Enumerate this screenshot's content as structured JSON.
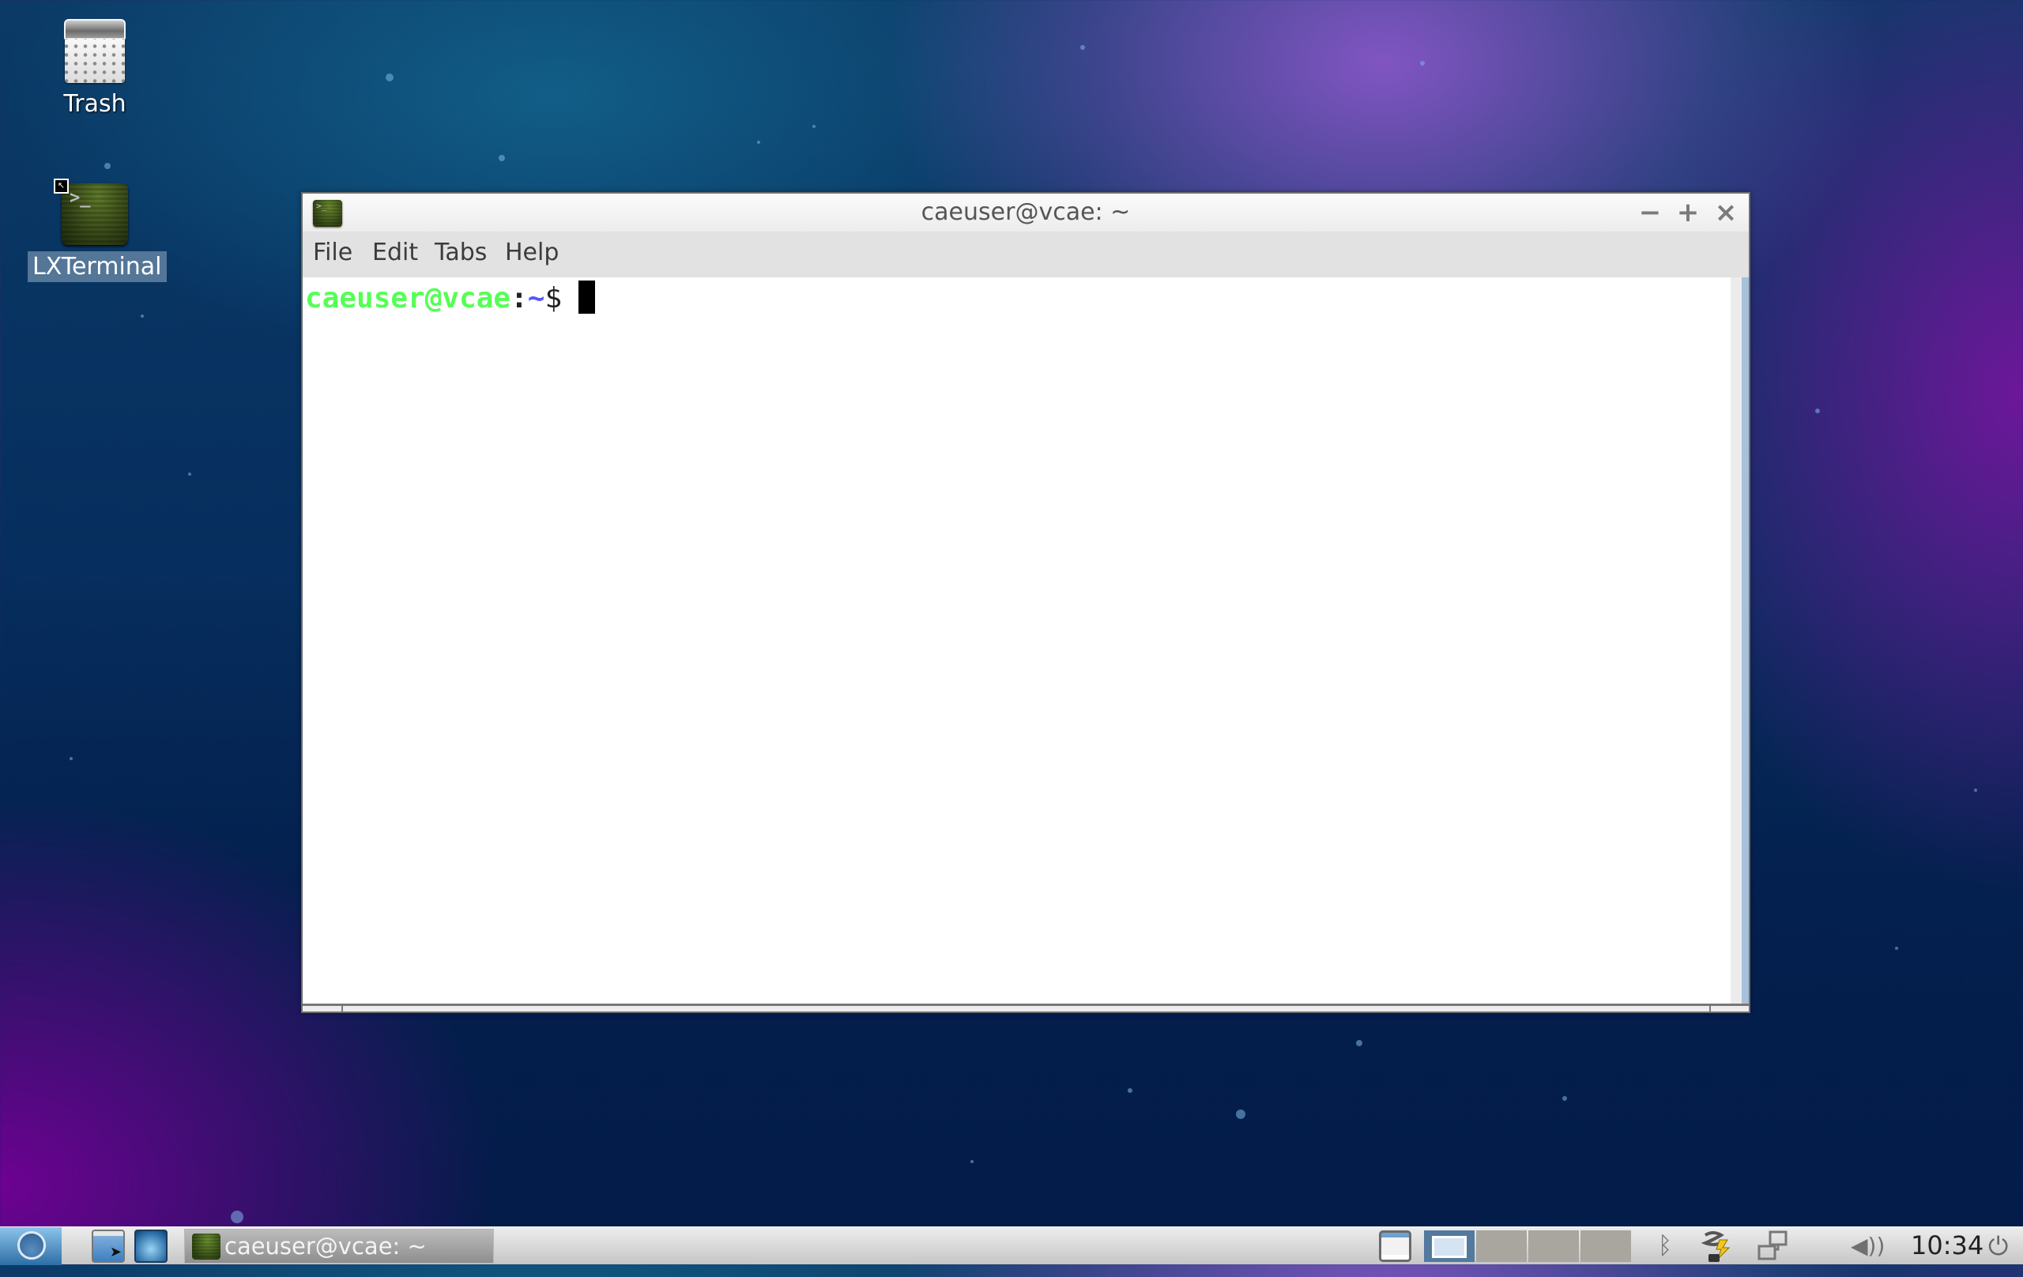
{
  "desktop": {
    "icons": [
      {
        "label": "Trash",
        "icon": "trash-icon"
      },
      {
        "label": "LXTerminal",
        "icon": "terminal-icon",
        "selected": true
      }
    ]
  },
  "window": {
    "title": "caeuser@vcae: ~",
    "controls": {
      "minimize": "−",
      "maximize": "+",
      "close": "×"
    },
    "menu": [
      "File",
      "Edit",
      "Tabs",
      "Help"
    ],
    "terminal": {
      "user_host": "caeuser@vcae",
      "colon": ":",
      "path": "~",
      "dollar": "$",
      "colors": {
        "user_host": "#55ff55",
        "path": "#5555ff"
      }
    }
  },
  "taskbar": {
    "launchers": [
      "file-manager",
      "web-browser"
    ],
    "task_button": {
      "label": "caeuser@vcae: ~"
    },
    "pager": {
      "desktops": 4,
      "active": 1
    },
    "tray": {
      "bluetooth": "bluetooth-icon",
      "power": "power-manager-icon",
      "network": "network-icon",
      "volume": "volume-icon"
    },
    "clock": "10:34",
    "glyphs": {
      "bluetooth": "ᛒ",
      "volume": "🔊",
      "power": "⏻"
    }
  }
}
